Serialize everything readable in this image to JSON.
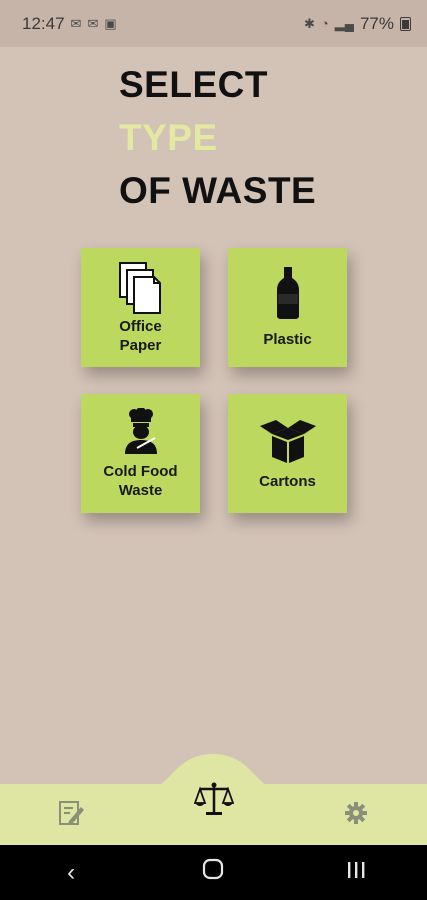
{
  "status": {
    "time": "12:47",
    "battery": "77%"
  },
  "title": {
    "line1": "SELECT",
    "line2": "TYPE",
    "line3": "OF WASTE"
  },
  "tiles": [
    {
      "label_line1": "Office",
      "label_line2": "Paper",
      "icon": "paper-stack-icon"
    },
    {
      "label_line1": "Plastic",
      "label_line2": "",
      "icon": "plastic-bottle-icon"
    },
    {
      "label_line1": "Cold Food",
      "label_line2": "Waste",
      "icon": "chef-icon"
    },
    {
      "label_line1": "Cartons",
      "label_line2": "",
      "icon": "box-icon"
    }
  ],
  "bottom_nav": {
    "left_icon": "edit-note-icon",
    "center_icon": "scale-icon",
    "right_icon": "gear-icon"
  },
  "colors": {
    "background": "#d3c2b6",
    "tile": "#bcd85e",
    "accent_text": "#e3e9a3",
    "bottom_bar": "#dfe6a4"
  }
}
